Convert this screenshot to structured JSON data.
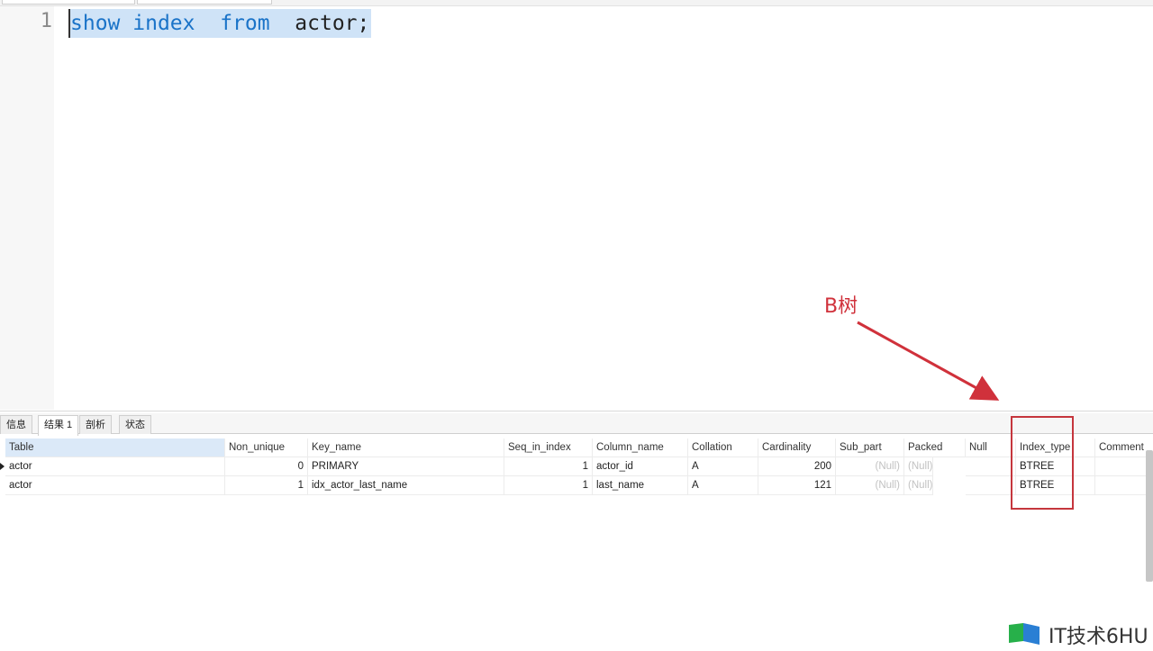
{
  "editor": {
    "line_number": "1",
    "tokens": [
      {
        "text": "show",
        "kind": "kw"
      },
      {
        "text": " ",
        "kind": "plain"
      },
      {
        "text": "index",
        "kind": "kw"
      },
      {
        "text": "  ",
        "kind": "plain"
      },
      {
        "text": "from",
        "kind": "kw"
      },
      {
        "text": "  actor;",
        "kind": "plain"
      }
    ]
  },
  "annotation": {
    "label": "B树",
    "color": "#d0313b"
  },
  "result_tabs": [
    "信息",
    "结果 1",
    "剖析",
    "状态"
  ],
  "active_tab": "结果 1",
  "table": {
    "columns": [
      "Table",
      "Non_unique",
      "Key_name",
      "Seq_in_index",
      "Column_name",
      "Collation",
      "Cardinality",
      "Sub_part",
      "Packed",
      "Null",
      "Index_type",
      "Comment"
    ],
    "rows": [
      [
        "actor",
        "0",
        "PRIMARY",
        "1",
        "actor_id",
        "A",
        "200",
        "(Null)",
        "(Null)",
        "",
        "BTREE",
        ""
      ],
      [
        "actor",
        "1",
        "idx_actor_last_name",
        "1",
        "last_name",
        "A",
        "121",
        "(Null)",
        "(Null)",
        "",
        "BTREE",
        ""
      ]
    ]
  },
  "watermark": {
    "text": "IT技术6HU",
    "icon": "book-logo-icon"
  }
}
